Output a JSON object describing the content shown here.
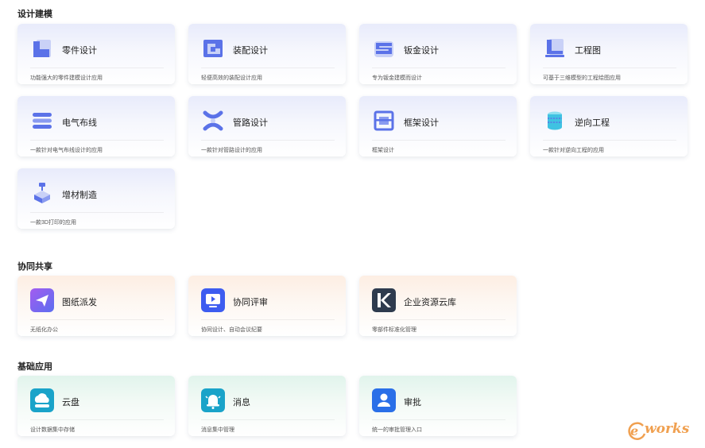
{
  "sections": [
    {
      "title": "设计建模"
    },
    {
      "title": "协同共享"
    },
    {
      "title": "基础应用"
    }
  ],
  "cards": [
    {
      "name": "零件设计",
      "desc": "功能强大的零件建模设计应用",
      "icon": "part-design-icon"
    },
    {
      "name": "装配设计",
      "desc": "轻便高效的装配设计应用",
      "icon": "assembly-design-icon"
    },
    {
      "name": "钣金设计",
      "desc": "专为钣金建模而设计",
      "icon": "sheet-metal-icon"
    },
    {
      "name": "工程图",
      "desc": "可基于三维模型的工程绘图应用",
      "icon": "drawing-icon"
    },
    {
      "name": "电气布线",
      "desc": "一款针对电气布线设计的应用",
      "icon": "electrical-wiring-icon"
    },
    {
      "name": "管路设计",
      "desc": "一款针对管路设计的应用",
      "icon": "piping-icon"
    },
    {
      "name": "框架设计",
      "desc": "框架设计",
      "icon": "frame-icon"
    },
    {
      "name": "逆向工程",
      "desc": "一款针对逆向工程的应用",
      "icon": "reverse-engineering-icon"
    },
    {
      "name": "增材制造",
      "desc": "一款3D打印的应用",
      "icon": "additive-manufacturing-icon"
    },
    {
      "name": "图纸派发",
      "desc": "无纸化办公",
      "icon": "paper-plane-icon"
    },
    {
      "name": "协同评审",
      "desc": "协同设计、自动会议纪要",
      "icon": "review-play-icon"
    },
    {
      "name": "企业资源云库",
      "desc": "零部件标准化管理",
      "icon": "k-logo-icon"
    },
    {
      "name": "云盘",
      "desc": "设计数据集中存储",
      "icon": "cloud-disk-icon"
    },
    {
      "name": "消息",
      "desc": "消息集中管理",
      "icon": "bell-icon"
    },
    {
      "name": "审批",
      "desc": "统一的审批管理入口",
      "icon": "approval-user-icon"
    }
  ],
  "watermark": {
    "text": "works",
    "prefix": "e"
  },
  "colors": {
    "blue_accent": "#5b72e8",
    "orange_card": "#fdeee3",
    "green_card": "#e1f4ec",
    "cloud_teal": "#1aa3c9"
  }
}
